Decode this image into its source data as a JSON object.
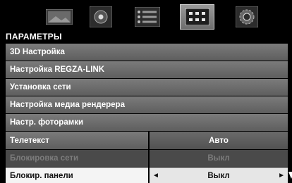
{
  "icons": [
    {
      "name": "picture-icon",
      "selected": false
    },
    {
      "name": "sound-icon",
      "selected": false
    },
    {
      "name": "list-icon",
      "selected": false
    },
    {
      "name": "settings-grid-icon",
      "selected": true
    },
    {
      "name": "setup-icon",
      "selected": false
    }
  ],
  "section_title": "ПАРАМЕТРЫ",
  "menu": [
    {
      "label": "3D Настройка"
    },
    {
      "label": "Настройка REGZA-LINK"
    },
    {
      "label": "Установка сети"
    },
    {
      "label": "Настройка медиа рендерера"
    },
    {
      "label": "Настр. фоторамки"
    },
    {
      "label": "Телетекст",
      "value": "Авто"
    },
    {
      "label": "Блокировка сети",
      "value": "Выкл",
      "disabled": true
    },
    {
      "label": "Блокир. панели",
      "value": "Выкл",
      "selected": true
    }
  ],
  "arrows": {
    "left": "◄",
    "right": "►"
  }
}
